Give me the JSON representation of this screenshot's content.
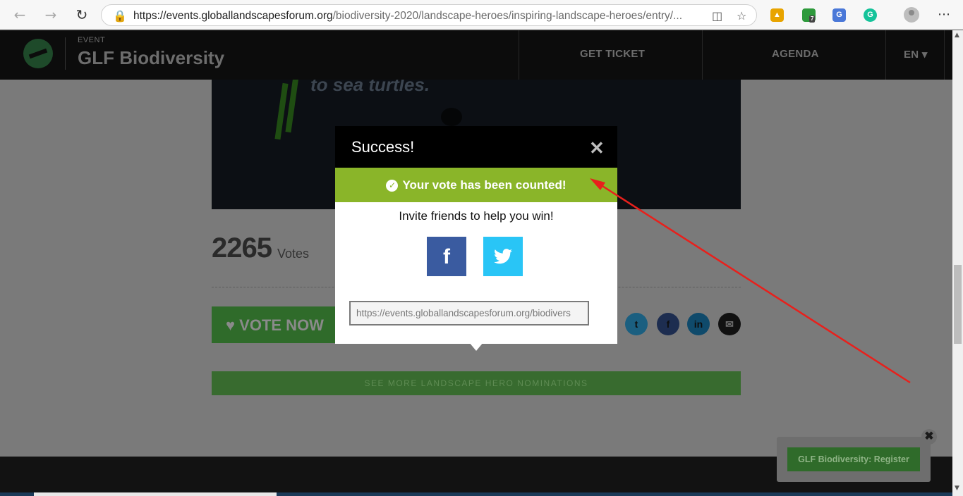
{
  "browser": {
    "url_host": "https://events.globallandscapesforum.org",
    "url_path": "/biodiversity-2020/landscape-heroes/inspiring-landscape-heroes/entry/...",
    "extension_badge": "7"
  },
  "site": {
    "event_label": "EVENT",
    "event_title": "GLF Biodiversity",
    "nav": {
      "get_ticket": "GET TICKET",
      "agenda": "AGENDA",
      "language": "EN ▾"
    }
  },
  "entry": {
    "video_caption": "to sea turtles.",
    "vote_count": "2265",
    "votes_label": "Votes",
    "vote_button": "♥ VOTE NOW",
    "see_more": "SEE MORE LANDSCAPE HERO NOMINATIONS"
  },
  "share_icons": [
    "twitter-icon",
    "facebook-icon",
    "linkedin-icon",
    "email-icon"
  ],
  "register": {
    "button": "GLF Biodiversity: Register",
    "close": "✖"
  },
  "modal": {
    "title": "Success!",
    "close": "✕",
    "banner": "Your vote has been counted!",
    "invite": "Invite friends to help you win!",
    "facebook_label": "f",
    "share_url": "https://events.globallandscapesforum.org/biodivers"
  },
  "colors": {
    "banner_green": "#8ab529",
    "facebook_blue": "#3a5ba0",
    "twitter_blue": "#29c5f6",
    "annotation_red": "#e8201c"
  }
}
